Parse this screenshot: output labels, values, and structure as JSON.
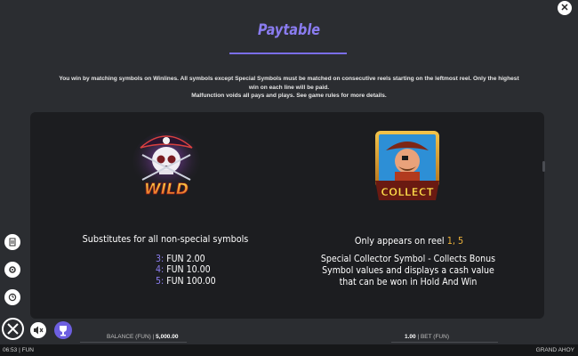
{
  "header": {
    "title": "Paytable",
    "close_icon": "close-icon"
  },
  "intro": {
    "line1": "You win by matching symbols on Winlines. All symbols except Special Symbols must be matched on consecutive reels starting on the leftmost reel. Only the highest win on each line will be paid.",
    "line2": "Malfunction voids all pays and plays. See game rules for more details."
  },
  "wild": {
    "symbol_text": "WILD",
    "description": "Substitutes for all non-special symbols",
    "pays": [
      {
        "count": "3:",
        "value": "FUN 2.00"
      },
      {
        "count": "4:",
        "value": "FUN 10.00"
      },
      {
        "count": "5:",
        "value": "FUN 100.00"
      }
    ]
  },
  "collect": {
    "symbol_text": "COLLECT",
    "reel_prefix": "Only appears on reel",
    "reel_numbers": "1, 5",
    "description": "Special Collector Symbol - Collects Bonus Symbol values and displays a cash value that can be won in Hold And Win"
  },
  "sidebar": {
    "icons": [
      "paytable-icon",
      "settings-icon",
      "history-icon"
    ]
  },
  "controls": {
    "close": "close-icon",
    "mute": "mute-icon",
    "trophy": "trophy-icon"
  },
  "status": {
    "balance_label": "BALANCE (FUN)",
    "balance_value": "5,000.00",
    "bet_value": "1.00",
    "bet_label": "BET (FUN)",
    "time": "06:53",
    "mode": "FUN",
    "game_name": "GRAND AHOY"
  },
  "colors": {
    "accent": "#8a7cf0",
    "reel_highlight": "#f0b43a",
    "background": "#2b2d31",
    "panel": "#1c1d20"
  }
}
